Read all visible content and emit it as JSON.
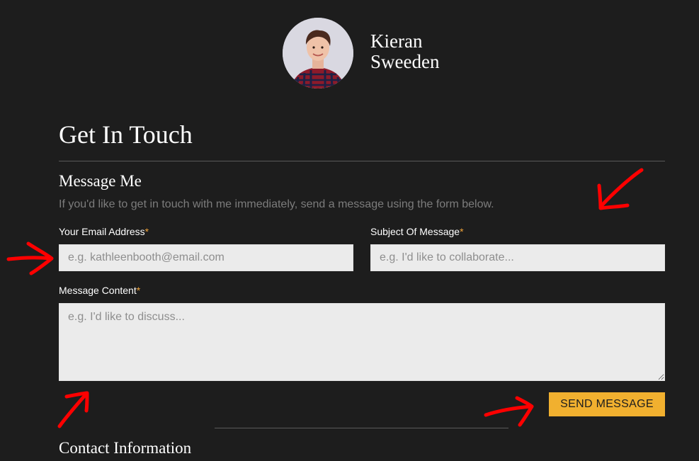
{
  "header": {
    "name_line1": "Kieran",
    "name_line2": "Sweeden"
  },
  "page": {
    "title": "Get In Touch"
  },
  "form": {
    "section_title": "Message Me",
    "description": "If you'd like to get in touch with me immediately, send a message using the form below.",
    "required_marker": "*",
    "email": {
      "label": "Your Email Address",
      "placeholder": "e.g. kathleenbooth@email.com",
      "value": ""
    },
    "subject": {
      "label": "Subject Of Message",
      "placeholder": "e.g. I'd like to collaborate...",
      "value": ""
    },
    "message": {
      "label": "Message Content",
      "placeholder": "e.g. I'd like to discuss...",
      "value": ""
    },
    "submit_label": "SEND MESSAGE"
  },
  "contact": {
    "title": "Contact Information"
  },
  "colors": {
    "background": "#1d1d1d",
    "accent": "#f1b02f",
    "required": "#f0a43a",
    "input_bg": "#ebebeb",
    "annotation_arrow": "#ff0000"
  },
  "icons": {
    "annotation": "red-arrow-icon"
  }
}
